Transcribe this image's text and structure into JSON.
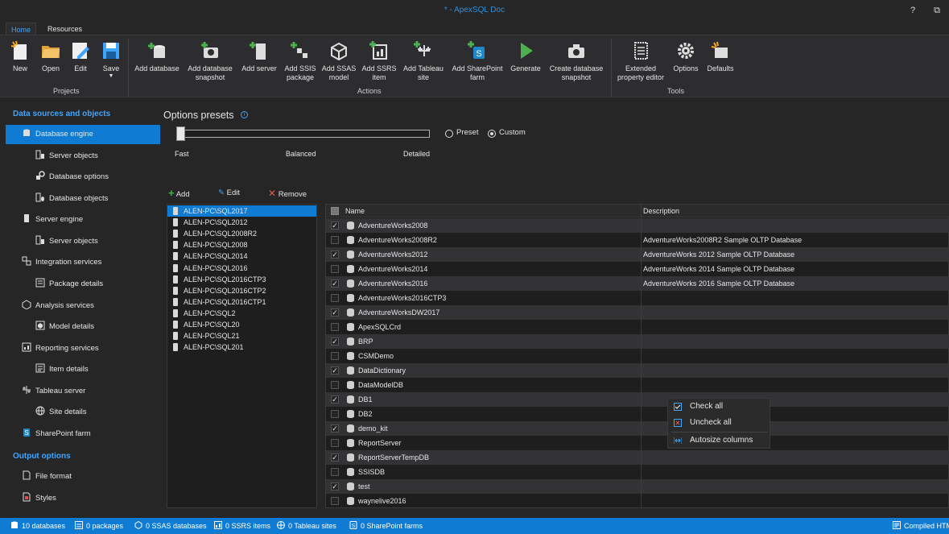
{
  "window": {
    "title": "* - ApexSQL Doc",
    "help": "?",
    "restore": "⧉"
  },
  "tabs": [
    {
      "label": "Home"
    },
    {
      "label": "Resources"
    }
  ],
  "ribbon": {
    "projects": {
      "label": "Projects",
      "new": "New",
      "open": "Open",
      "edit": "Edit",
      "save": "Save"
    },
    "actions": {
      "label": "Actions",
      "add_database": "Add database",
      "add_db_snapshot": [
        "Add database",
        "snapshot"
      ],
      "add_server": "Add server",
      "add_ssis": [
        "Add SSIS",
        "package"
      ],
      "add_ssas": [
        "Add SSAS",
        "model"
      ],
      "add_ssrs": [
        "Add SSRS",
        "item"
      ],
      "add_tableau": [
        "Add Tableau",
        "site"
      ],
      "add_sharepoint": [
        "Add SharePoint",
        "farm"
      ],
      "generate": "Generate",
      "create_snapshot": [
        "Create database",
        "snapshot"
      ]
    },
    "tools": {
      "label": "Tools",
      "extended": [
        "Extended",
        "property editor"
      ],
      "options": "Options",
      "defaults": "Defaults"
    }
  },
  "nav": {
    "section1": "Data sources and objects",
    "items": [
      {
        "label": "Database engine",
        "icon": "database-icon"
      },
      {
        "label": "Server objects",
        "icon": "server-objects-icon"
      },
      {
        "label": "Database options",
        "icon": "database-options-icon"
      },
      {
        "label": "Database objects",
        "icon": "database-objects-icon"
      },
      {
        "label": "Server engine",
        "icon": "server-icon"
      },
      {
        "label": "Server objects",
        "icon": "server-objects-icon"
      },
      {
        "label": "Integration services",
        "icon": "integration-icon"
      },
      {
        "label": "Package details",
        "icon": "package-icon"
      },
      {
        "label": "Analysis services",
        "icon": "cube-icon"
      },
      {
        "label": "Model details",
        "icon": "model-icon"
      },
      {
        "label": "Reporting services",
        "icon": "report-icon"
      },
      {
        "label": "Item details",
        "icon": "item-icon"
      },
      {
        "label": "Tableau server",
        "icon": "tableau-icon"
      },
      {
        "label": "Site details",
        "icon": "globe-icon"
      },
      {
        "label": "SharePoint farm",
        "icon": "sharepoint-icon"
      }
    ],
    "section2": "Output options",
    "output": [
      {
        "label": "File format",
        "icon": "file-icon"
      },
      {
        "label": "Styles",
        "icon": "styles-icon"
      }
    ]
  },
  "presets": {
    "title": "Options presets",
    "fast": "Fast",
    "balanced": "Balanced",
    "detailed": "Detailed",
    "preset": "Preset",
    "custom": "Custom",
    "slider_level": 0
  },
  "toolbar": {
    "add": "Add",
    "edit": "Edit",
    "remove": "Remove"
  },
  "servers": [
    "ALEN-PC\\SQL2017",
    "ALEN-PC\\SQL2012",
    "ALEN-PC\\SQL2008R2",
    "ALEN-PC\\SQL2008",
    "ALEN-PC\\SQL2014",
    "ALEN-PC\\SQL2016",
    "ALEN-PC\\SQL2016CTP3",
    "ALEN-PC\\SQL2016CTP2",
    "ALEN-PC\\SQL2016CTP1",
    "ALEN-PC\\SQL2",
    "ALEN-PC\\SQL20",
    "ALEN-PC\\SQL21",
    "ALEN-PC\\SQL201"
  ],
  "grid": {
    "col_name": "Name",
    "col_desc": "Description",
    "rows": [
      {
        "checked": true,
        "name": "AdventureWorks2008",
        "desc": ""
      },
      {
        "checked": false,
        "name": "AdventureWorks2008R2",
        "desc": "AdventureWorks2008R2 Sample OLTP Database"
      },
      {
        "checked": true,
        "name": "AdventureWorks2012",
        "desc": "AdventureWorks 2012 Sample OLTP Database"
      },
      {
        "checked": false,
        "name": "AdventureWorks2014",
        "desc": "AdventureWorks 2014 Sample OLTP Database"
      },
      {
        "checked": true,
        "name": "AdventureWorks2016",
        "desc": "AdventureWorks 2016 Sample OLTP Database"
      },
      {
        "checked": false,
        "name": "AdventureWorks2016CTP3",
        "desc": ""
      },
      {
        "checked": true,
        "name": "AdventureWorksDW2017",
        "desc": ""
      },
      {
        "checked": false,
        "name": "ApexSQLCrd",
        "desc": ""
      },
      {
        "checked": true,
        "name": "BRP",
        "desc": ""
      },
      {
        "checked": false,
        "name": "CSMDemo",
        "desc": ""
      },
      {
        "checked": true,
        "name": "DataDictionary",
        "desc": ""
      },
      {
        "checked": false,
        "name": "DataModelDB",
        "desc": ""
      },
      {
        "checked": true,
        "name": "DB1",
        "desc": ""
      },
      {
        "checked": false,
        "name": "DB2",
        "desc": ""
      },
      {
        "checked": true,
        "name": "demo_kit",
        "desc": ""
      },
      {
        "checked": false,
        "name": "ReportServer",
        "desc": ""
      },
      {
        "checked": true,
        "name": "ReportServerTempDB",
        "desc": ""
      },
      {
        "checked": false,
        "name": "SSISDB",
        "desc": ""
      },
      {
        "checked": true,
        "name": "test",
        "desc": ""
      },
      {
        "checked": false,
        "name": "waynelive2016",
        "desc": ""
      }
    ]
  },
  "context_menu": {
    "check_all": "Check all",
    "uncheck_all": "Uncheck all",
    "autosize": "Autosize columns"
  },
  "status": {
    "databases": "10 databases",
    "packages": "0 packages",
    "ssas": "0 SSAS databases",
    "ssrs": "0 SSRS items",
    "tableau": "0 Tableau sites",
    "sharepoint": "0 SharePoint farms",
    "compiled": "Compiled HTM"
  },
  "colors": {
    "accent": "#0f7bd3",
    "link": "#3ea6ff",
    "bg": "#262626"
  }
}
